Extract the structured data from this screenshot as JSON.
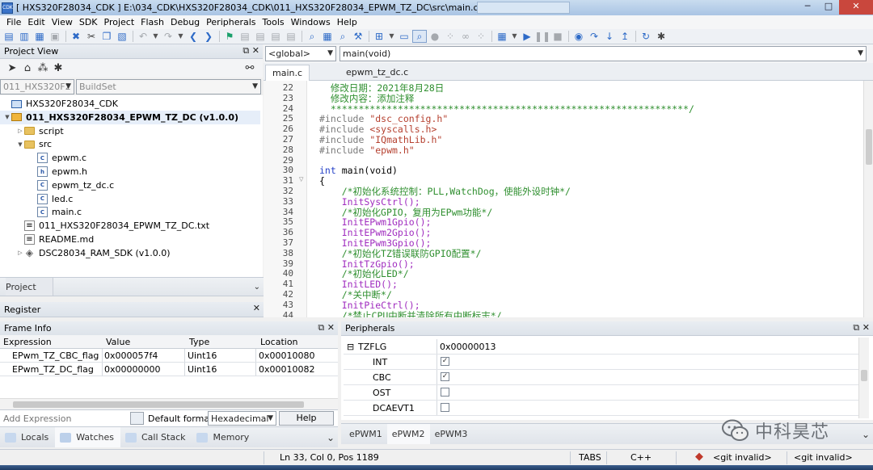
{
  "window": {
    "title": "[ HXS320F28034_CDK ] E:\\034_CDK\\HXS320F28034_CDK\\011_HXS320F28034_EPWM_TZ_DC\\src\\main.c",
    "app_icon": "CDK"
  },
  "menu": [
    "File",
    "Edit",
    "View",
    "SDK",
    "Project",
    "Flash",
    "Debug",
    "Peripherals",
    "Tools",
    "Windows",
    "Help"
  ],
  "project_view": {
    "title": "Project View",
    "project_combo": "011_HXS320F2",
    "buildset_combo": "BuildSet",
    "tree": [
      {
        "label": "HXS320F28034_CDK",
        "icon": "monitor-icon",
        "depth": 0,
        "expander": ""
      },
      {
        "label": "011_HXS320F28034_EPWM_TZ_DC (v1.0.0)",
        "icon": "project-icon",
        "depth": 0,
        "expander": "▼",
        "bold": true
      },
      {
        "label": "script",
        "icon": "folder-icon",
        "depth": 1,
        "expander": "▷"
      },
      {
        "label": "src",
        "icon": "folder-icon",
        "depth": 1,
        "expander": "▼"
      },
      {
        "label": "epwm.c",
        "icon": "c-file-icon",
        "depth": 2,
        "expander": ""
      },
      {
        "label": "epwm.h",
        "icon": "h-file-icon",
        "depth": 2,
        "expander": ""
      },
      {
        "label": "epwm_tz_dc.c",
        "icon": "c-file-icon",
        "depth": 2,
        "expander": ""
      },
      {
        "label": "led.c",
        "icon": "c-file-icon",
        "depth": 2,
        "expander": ""
      },
      {
        "label": "main.c",
        "icon": "c-file-icon",
        "depth": 2,
        "expander": ""
      },
      {
        "label": "011_HXS320F28034_EPWM_TZ_DC.txt",
        "icon": "text-file-icon",
        "depth": 1,
        "expander": ""
      },
      {
        "label": "README.md",
        "icon": "text-file-icon",
        "depth": 1,
        "expander": ""
      },
      {
        "label": "DSC28034_RAM_SDK (v1.0.0)",
        "icon": "package-icon",
        "depth": 1,
        "expander": "▷"
      }
    ],
    "project_tab": "Project",
    "register_tab": "Register"
  },
  "editor": {
    "scope_combo": "<global>",
    "function_combo": "main(void)",
    "tabs": [
      "main.c",
      "epwm_tz_dc.c"
    ],
    "active_tab": "main.c",
    "lines": [
      {
        "n": "22",
        "text": "  修改日期：2021年8月28日",
        "cls": "c-comment"
      },
      {
        "n": "23",
        "text": "  修改内容：添加注释",
        "cls": "c-comment"
      },
      {
        "n": "24",
        "text": "  ****************************************************************/",
        "cls": "c-comment"
      },
      {
        "n": "25",
        "text": "#include \"dsc_config.h\"",
        "cls": "pre"
      },
      {
        "n": "26",
        "text": "#include <syscalls.h>",
        "cls": "pre"
      },
      {
        "n": "27",
        "text": "#include \"IQmathLib.h\"",
        "cls": "pre"
      },
      {
        "n": "28",
        "text": "#include \"epwm.h\"",
        "cls": "pre"
      },
      {
        "n": "29",
        "text": "",
        "cls": "c-plain"
      },
      {
        "n": "30",
        "text": "int main(void)",
        "cls": "kwfn"
      },
      {
        "n": "31",
        "text": "{",
        "cls": "c-plain"
      },
      {
        "n": "32",
        "text": "    /*初始化系统控制：PLL,WatchDog，使能外设时钟*/",
        "cls": "c-comment"
      },
      {
        "n": "33",
        "text": "    InitSysCtrl();",
        "cls": "c-fn"
      },
      {
        "n": "34",
        "text": "    /*初始化GPIO，复用为EPwm功能*/",
        "cls": "c-comment"
      },
      {
        "n": "35",
        "text": "    InitEPwm1Gpio();",
        "cls": "c-fn"
      },
      {
        "n": "36",
        "text": "    InitEPwm2Gpio();",
        "cls": "c-fn"
      },
      {
        "n": "37",
        "text": "    InitEPwm3Gpio();",
        "cls": "c-fn"
      },
      {
        "n": "38",
        "text": "    /*初始化TZ错误联防GPIO配置*/",
        "cls": "c-comment"
      },
      {
        "n": "39",
        "text": "    InitTzGpio();",
        "cls": "c-fn"
      },
      {
        "n": "40",
        "text": "    /*初始化LED*/",
        "cls": "c-comment"
      },
      {
        "n": "41",
        "text": "    InitLED();",
        "cls": "c-fn"
      },
      {
        "n": "42",
        "text": "    /*关中断*/",
        "cls": "c-comment"
      },
      {
        "n": "43",
        "text": "    InitPieCtrl();",
        "cls": "c-fn"
      },
      {
        "n": "44",
        "text": "    /*禁止CPU中断并清除所有中断标志*/",
        "cls": "c-comment"
      }
    ]
  },
  "frame_info": {
    "title": "Frame Info",
    "columns": [
      "Expression",
      "Value",
      "Type",
      "Location"
    ],
    "rows": [
      [
        "EPwm_TZ_CBC_flag",
        "0x000057f4",
        "Uint16",
        "0x00010080"
      ],
      [
        "EPwm_TZ_DC_flag",
        "0x00000000",
        "Uint16",
        "0x00010082"
      ]
    ],
    "add_expression_placeholder": "Add Expression",
    "default_format_label": "Default format",
    "format_value": "Hexadecimal",
    "help_button": "Help",
    "tabs": [
      "Locals",
      "Watches",
      "Call Stack",
      "Memory"
    ]
  },
  "peripherals": {
    "title": "Peripherals",
    "rows": [
      {
        "name": "TZFLG",
        "value": "0x00000013",
        "type": "group"
      },
      {
        "name": "INT",
        "checked": true,
        "type": "flag"
      },
      {
        "name": "CBC",
        "checked": true,
        "type": "flag"
      },
      {
        "name": "OST",
        "checked": false,
        "type": "flag"
      },
      {
        "name": "DCAEVT1",
        "checked": false,
        "type": "flag"
      }
    ],
    "tabs": [
      "ePWM1",
      "ePWM2",
      "ePWM3"
    ],
    "active_tab": "ePWM2"
  },
  "status": {
    "position": "Ln 33, Col 0, Pos 1189",
    "tabs_mode": "TABS",
    "language": "C++",
    "git1": "<git invalid>",
    "git2": "<git invalid>"
  },
  "watermark": "中科昊芯"
}
